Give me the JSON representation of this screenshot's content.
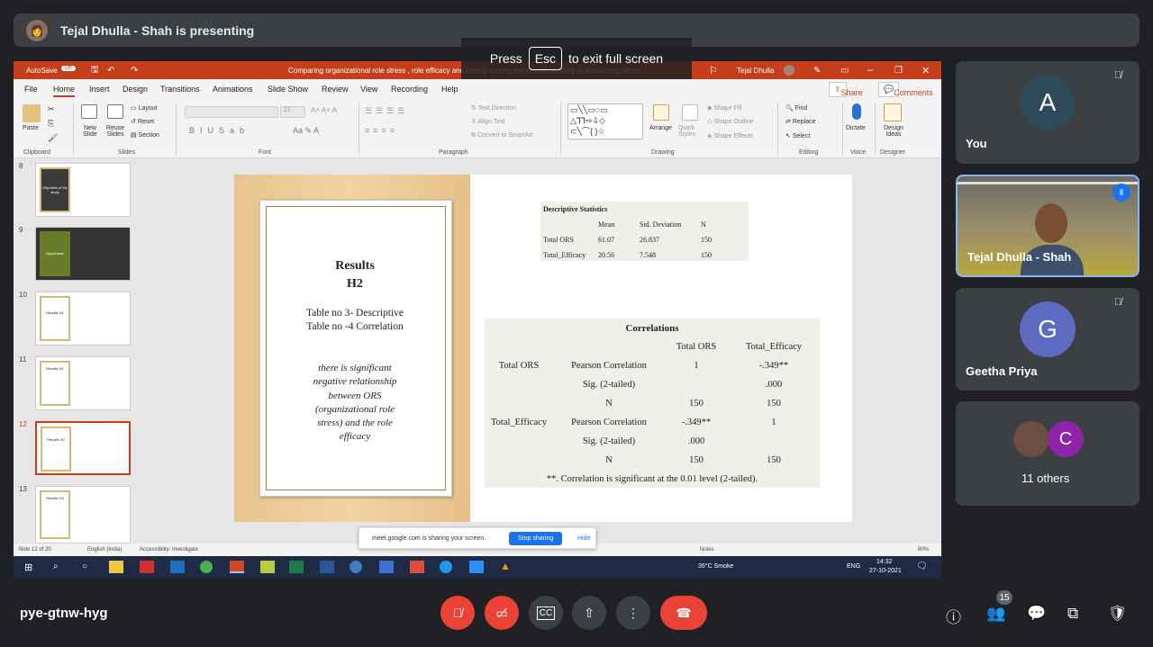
{
  "presenter_bar": {
    "text": "Tejal Dhulla - Shah is presenting",
    "avatar": "avatar-icon"
  },
  "escape_hint": {
    "press": "Press",
    "key": "Esc",
    "rest": "to exit full screen"
  },
  "ppt": {
    "autosave": "AutoSave",
    "autosave_state": "Off",
    "doc_title": "Comparing organizational role stress , role efficacy and coping among the women working in accounting sector",
    "user": "Tejal Dhulla",
    "menu": [
      "File",
      "Home",
      "Insert",
      "Design",
      "Transitions",
      "Animations",
      "Slide Show",
      "Review",
      "View",
      "Recording",
      "Help"
    ],
    "share_btn": "Share",
    "comments_btn": "Comments",
    "ribbon": {
      "paste": "Paste",
      "new_slide": "New Slide",
      "reuse": "Reuse Slides",
      "layout": "Layout",
      "reset": "Reset",
      "section": "Section",
      "font_size": "21",
      "text_direction": "Text Direction",
      "align_text": "Align Text",
      "smartart": "Convert to SmartArt",
      "arrange": "Arrange",
      "quick_styles": "Quick Styles",
      "shape_fill": "Shape Fill",
      "shape_outline": "Shape Outline",
      "shape_effects": "Shape Effects",
      "find": "Find",
      "replace": "Replace",
      "select": "Select",
      "dictate": "Dictate",
      "design_ideas": "Design Ideas",
      "groups": [
        "Clipboard",
        "Slides",
        "Font",
        "Paragraph",
        "Drawing",
        "Editing",
        "Voice",
        "Designer"
      ]
    },
    "thumbnails": [
      {
        "num": "8",
        "label": "Objective of the study"
      },
      {
        "num": "9",
        "label": "Hypothesis"
      },
      {
        "num": "10",
        "label": "Results H1"
      },
      {
        "num": "11",
        "label": "Results H1"
      },
      {
        "num": "12",
        "label": "Results H2"
      },
      {
        "num": "13",
        "label": "Results H3"
      }
    ],
    "slide": {
      "title1": "Results",
      "title2": "H2",
      "sub1": "Table no 3- Descriptive",
      "sub2": "Table no -4 Correlation",
      "desc": [
        "there is significant",
        "negative relationship",
        "between ORS",
        "(organizational role",
        "stress) and the role",
        "efficacy"
      ],
      "desc_table": {
        "title": "Descriptive Statistics",
        "headers": [
          "",
          "Mean",
          "Std. Deviation",
          "N"
        ],
        "rows": [
          [
            "Total ORS",
            "61.07",
            "26.837",
            "150"
          ],
          [
            "Total_Efficacy",
            "20.56",
            "7.548",
            "150"
          ]
        ]
      },
      "corr_table": {
        "title": "Correlations",
        "headers": [
          "",
          "",
          "Total ORS",
          "Total_Efficacy"
        ],
        "rows": [
          [
            "Total ORS",
            "Pearson Correlation",
            "1",
            "-.349**"
          ],
          [
            "",
            "Sig. (2-tailed)",
            "",
            ".000"
          ],
          [
            "",
            "N",
            "150",
            "150"
          ],
          [
            "Total_Efficacy",
            "Pearson Correlation",
            "-.349**",
            "1"
          ],
          [
            "",
            "Sig. (2-tailed)",
            ".000",
            ""
          ],
          [
            "",
            "N",
            "150",
            "150"
          ]
        ],
        "footnote": "**. Correlation is significant at the 0.01 level (2-tailed)."
      }
    },
    "status": {
      "slide": "Slide 12 of 20",
      "lang": "English (India)",
      "accessibility": "Accessibility: Investigate",
      "notes": "Notes",
      "zoom": "80%"
    },
    "sharing": {
      "text": "meet.google.com is sharing your screen.",
      "stop": "Stop sharing",
      "hide": "Hide"
    },
    "taskbar": {
      "weather": "35°C  Smoke",
      "lang": "ENG",
      "time": "14:32",
      "date": "27-10-2021"
    }
  },
  "participants": [
    {
      "name": "You",
      "initial": "A",
      "color": "#2e4a58"
    },
    {
      "name": "Tejal Dhulla - Shah"
    },
    {
      "name": "Geetha Priya",
      "initial": "G",
      "color": "#5c6bc0"
    },
    {
      "name": "11 others",
      "initial": "C",
      "color": "#8e24aa"
    }
  ],
  "bottom": {
    "meeting_code": "pye-gtnw-hyg",
    "people_count": "15"
  }
}
